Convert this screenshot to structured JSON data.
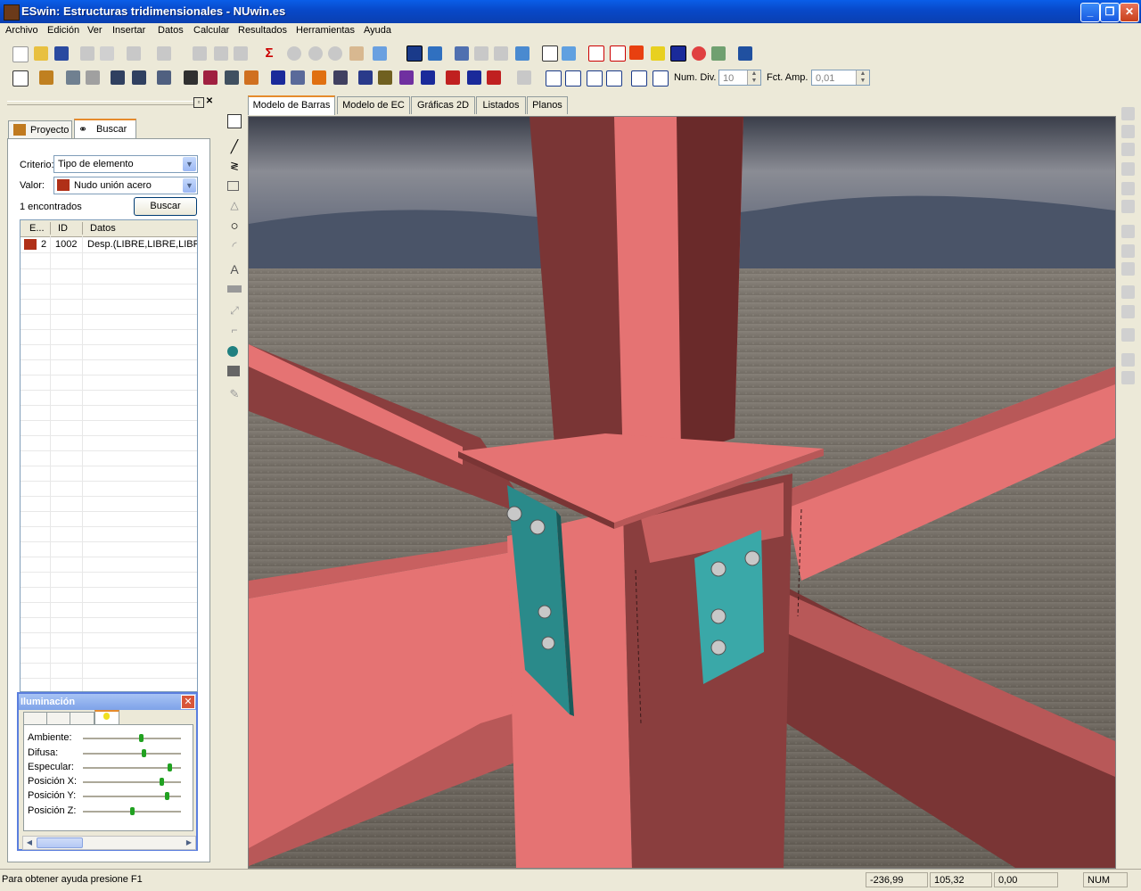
{
  "window": {
    "title": "ESwin: Estructuras tridimensionales - NUwin.es"
  },
  "menu": [
    "Archivo",
    "Edición",
    "Ver",
    "Insertar",
    "Datos",
    "Calcular",
    "Resultados",
    "Herramientas",
    "Ayuda"
  ],
  "toolbar2": {
    "num_div_label": "Num. Div.",
    "num_div_value": "10",
    "fct_amp_label": "Fct. Amp.",
    "fct_amp_value": "0,01"
  },
  "left_panel": {
    "tabs": [
      "Proyecto",
      "Buscar"
    ],
    "criterio_label": "Criterio:",
    "criterio_value": "Tipo de elemento",
    "valor_label": "Valor:",
    "valor_value": "Nudo unión acero",
    "found_text": "1 encontrados",
    "search_button": "Buscar",
    "columns": [
      "E...",
      "ID",
      "Datos"
    ],
    "rows": [
      {
        "e": "2",
        "id": "1002",
        "datos": "Desp.(LIBRE,LIBRE,LIBR"
      }
    ]
  },
  "lighting": {
    "title": "Iluminación",
    "close": "✕",
    "sliders": [
      {
        "label": "Ambiente:",
        "value": 0.6
      },
      {
        "label": "Difusa:",
        "value": 0.63
      },
      {
        "label": "Especular:",
        "value": 0.9
      },
      {
        "label": "Posición X:",
        "value": 0.82
      },
      {
        "label": "Posición Y:",
        "value": 0.88
      },
      {
        "label": "Posición Z:",
        "value": 0.5
      }
    ]
  },
  "view_tabs": [
    "Modelo de Barras",
    "Modelo de EC",
    "Gráficas 2D",
    "Listados",
    "Planos"
  ],
  "status": {
    "help": "Para obtener ayuda presione F1",
    "x": "-236,99",
    "y": "105,32",
    "z": "0,00",
    "num": "NUM"
  },
  "colors": {
    "steel": "#e57373",
    "steel_dark": "#7a3535",
    "plate": "#3aa0a0",
    "ground": "#6e665e"
  }
}
